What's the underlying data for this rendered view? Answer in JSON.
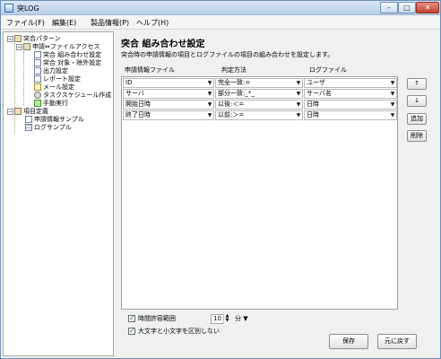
{
  "window": {
    "title": "突LOG"
  },
  "menubar": {
    "items": [
      "ファイル(F)",
      "編集(E)",
      "製品情報(P)",
      "ヘルプ(H)"
    ]
  },
  "tree": {
    "nodes": [
      {
        "label": "突合パターン",
        "icon": "folder-icon",
        "toggle": "−"
      },
      {
        "label": "申請⇔ファイルアクセス",
        "icon": "folder-icon",
        "toggle": "−"
      },
      {
        "label": "突合 組み合わせ設定",
        "icon": "document-icon"
      },
      {
        "label": "突合 対象・除外設定",
        "icon": "document-icon"
      },
      {
        "label": "出力設定",
        "icon": "document-icon"
      },
      {
        "label": "レポート設定",
        "icon": "document-icon"
      },
      {
        "label": "メール設定",
        "icon": "mail-icon"
      },
      {
        "label": "タスクスケジュール作成",
        "icon": "gear-icon"
      },
      {
        "label": "手動実行",
        "icon": "run-icon"
      },
      {
        "label": "項目定義",
        "icon": "folder-icon",
        "toggle": "−"
      },
      {
        "label": "申請情報サンプル",
        "icon": "document-icon"
      },
      {
        "label": "ログサンプル",
        "icon": "grid-icon"
      }
    ]
  },
  "main": {
    "title": "突合 組み合わせ設定",
    "description": "突合時の申請情報の項目とログファイルの項目の組み合わせを設定します。",
    "columns": [
      "申請情報ファイル",
      "判定方法",
      "ログファイル"
    ],
    "rows": [
      [
        "ID",
        "完全一致:=",
        "ユーザ"
      ],
      [
        "サーバ",
        "部分一致:_*_",
        "サーバ名"
      ],
      [
        "開始日時",
        "以後:＜=",
        "日時"
      ],
      [
        "終了日時",
        "以前:＞=",
        "日時"
      ]
    ],
    "side_buttons": {
      "up": "↑",
      "down": "↓",
      "add": "追加",
      "delete": "削除"
    },
    "time_tolerance": {
      "label": "時間許容範囲",
      "value": "10",
      "unit": "分",
      "checked": true
    },
    "ignore_case": {
      "label": "大文字と小文字を区別しない",
      "checked": true
    },
    "save_button": "保存",
    "revert_button": "元に戻す"
  },
  "colors": {
    "accent": "#b9d0ea",
    "check": "#1a7a1a"
  }
}
